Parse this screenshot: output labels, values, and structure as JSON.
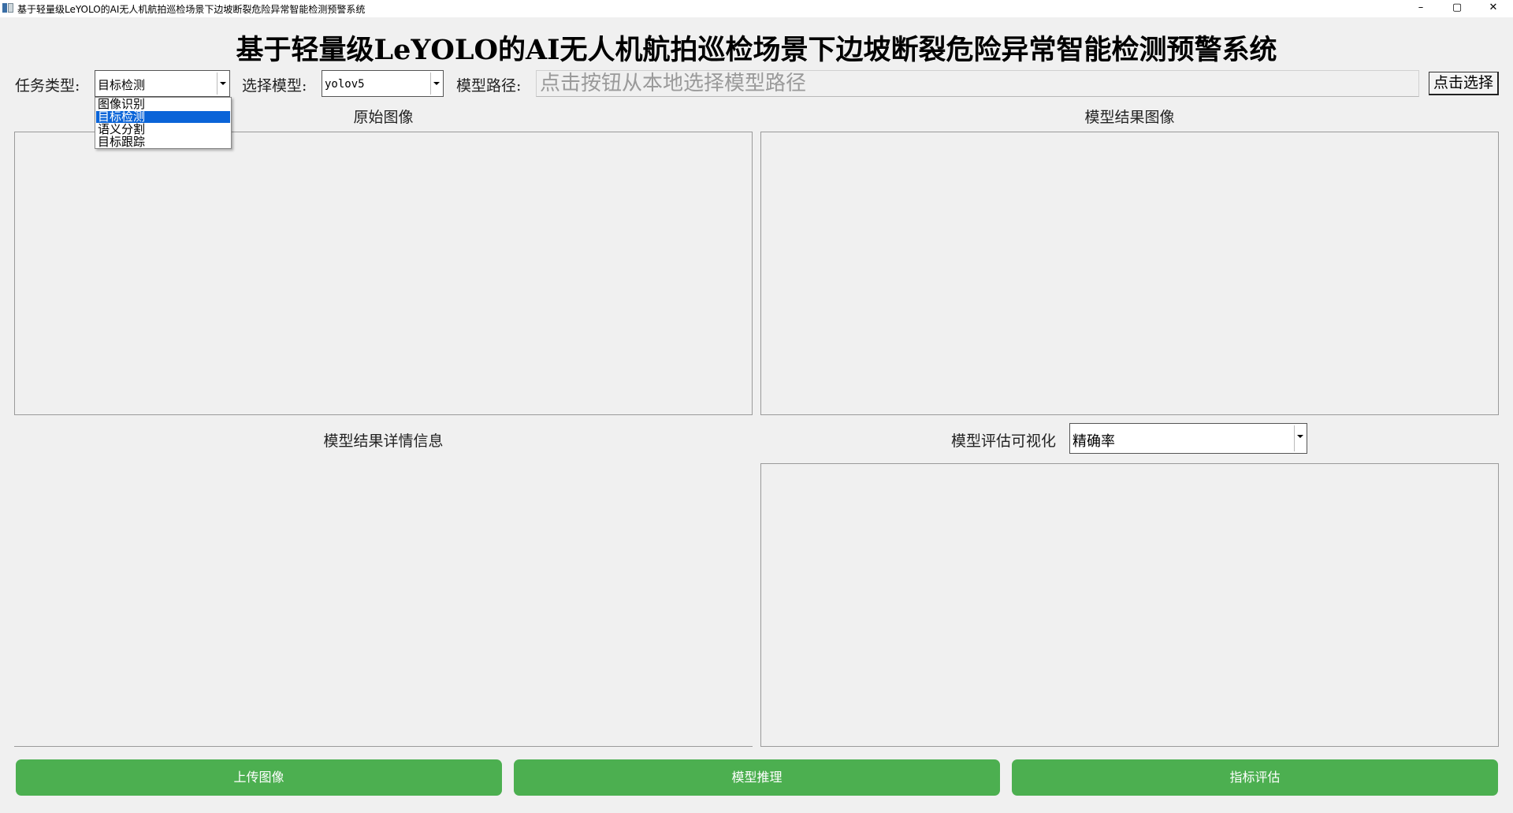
{
  "window": {
    "title": "基于轻量级LeYOLO的AI无人机航拍巡检场景下边坡断裂危险异常智能检测预警系统",
    "minimize": "–",
    "maximize": "▢",
    "close": "✕"
  },
  "header": {
    "title": "基于轻量级LeYOLO的AI无人机航拍巡检场景下边坡断裂危险异常智能检测预警系统"
  },
  "toolbar": {
    "task_type_label": "任务类型:",
    "task_type_value": "目标检测",
    "task_type_options": [
      "图像识别",
      "目标检测",
      "语义分割",
      "目标跟踪"
    ],
    "model_label": "选择模型:",
    "model_value": "yolov5",
    "model_path_label": "模型路径:",
    "model_path_placeholder": "点击按钮从本地选择模型路径",
    "pick_button": "点击选择"
  },
  "panels": {
    "original_image_title": "原始图像",
    "result_image_title": "模型结果图像",
    "detail_info_title": "模型结果详情信息",
    "eval_vis_label": "模型评估可视化",
    "eval_metric_value": "精确率"
  },
  "actions": {
    "upload": "上传图像",
    "infer": "模型推理",
    "evaluate": "指标评估"
  },
  "colors": {
    "accent_green": "#4caf50",
    "selection_blue": "#0a64d8"
  }
}
